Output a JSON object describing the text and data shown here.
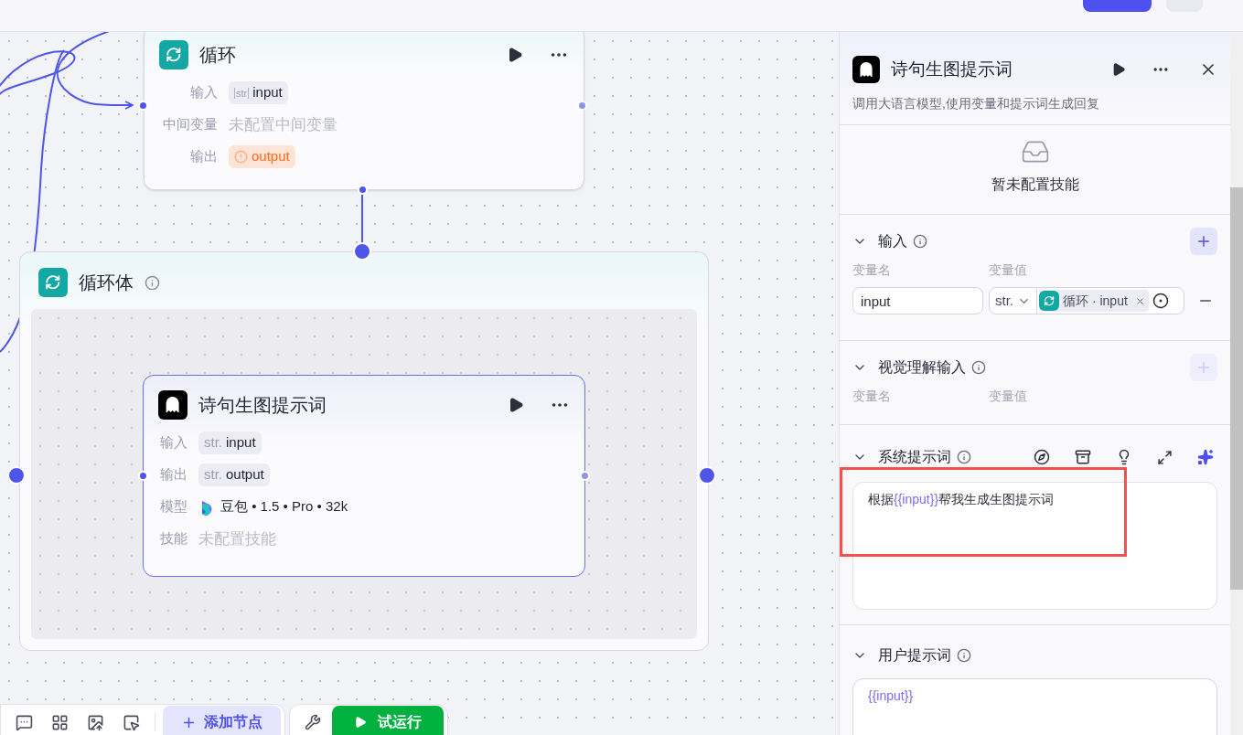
{
  "canvas": {
    "loop_node": {
      "title": "循环",
      "rows": [
        {
          "label": "输入",
          "kind": "bracket_variable",
          "type": "str",
          "value": "input"
        },
        {
          "label": "中间变量",
          "kind": "placeholder",
          "value": "未配置中间变量"
        },
        {
          "label": "输出",
          "kind": "error",
          "value": "output"
        }
      ]
    },
    "loop_body": {
      "title": "循环体"
    },
    "llm_node": {
      "title": "诗句生图提示词",
      "selected": true,
      "rows": [
        {
          "label": "输入",
          "kind": "variable",
          "type": "str.",
          "value": "input"
        },
        {
          "label": "输出",
          "kind": "variable",
          "type": "str.",
          "value": "output"
        },
        {
          "label": "模型",
          "kind": "model",
          "value": "豆包 • 1.5 • Pro • 32k"
        },
        {
          "label": "技能",
          "kind": "placeholder",
          "value": "未配置技能"
        }
      ]
    }
  },
  "bottom_toolbar": {
    "add_node_button": "添加节点",
    "test_run_button": "试运行"
  },
  "panel": {
    "title": "诗句生图提示词",
    "description": "调用大语言模型,使用变量和提示词生成回复",
    "skills_empty": "暂未配置技能",
    "input_section": {
      "title": "输入",
      "add_disabled": false,
      "columns": [
        "变量名",
        "变量值"
      ],
      "rows": [
        {
          "name": "input",
          "type": "str.",
          "ref_node": "循环",
          "ref_var": "· input"
        }
      ]
    },
    "vision_section": {
      "title": "视觉理解输入",
      "add_disabled": true,
      "columns": [
        "变量名",
        "变量值"
      ]
    },
    "system_prompt": {
      "title": "系统提示词",
      "segments": [
        {
          "kind": "plain",
          "text": "根据"
        },
        {
          "kind": "variable",
          "text": "{{input}}"
        },
        {
          "kind": "plain",
          "text": "帮我生成生图提示词"
        }
      ]
    },
    "user_prompt": {
      "title": "用户提示词",
      "segments": [
        {
          "kind": "variable",
          "text": "{{input}}"
        }
      ]
    }
  }
}
